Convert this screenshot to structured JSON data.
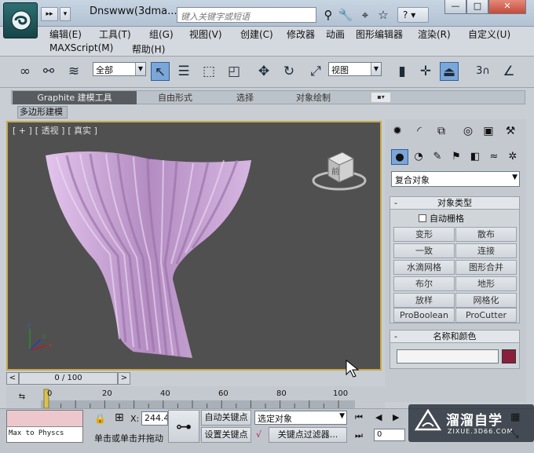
{
  "titlebar": {
    "doc_title": "Dnswww(3dma...",
    "search_placeholder": "键入关键字或短语",
    "help_label": "?",
    "window_buttons": [
      "—",
      "□",
      "✕"
    ],
    "qat_labels": [
      "▸▸",
      "▾"
    ]
  },
  "menus": {
    "row1": [
      "编辑(E)",
      "工具(T)",
      "组(G)",
      "视图(V)",
      "创建(C)",
      "修改器",
      "动画",
      "图形编辑器",
      "渲染(R)",
      "自定义(U)"
    ],
    "row2": [
      "MAXScript(M)",
      "帮助(H)"
    ]
  },
  "toolbar": {
    "selection_filter": "全部",
    "ref_coord": "视图",
    "snap_label": "3"
  },
  "ribbon": {
    "tabs": [
      "Graphite 建模工具",
      "自由形式",
      "选择",
      "对象绘制"
    ],
    "panel_label": "多边形建模"
  },
  "viewport": {
    "labels": [
      "[ + ]",
      "[ 透视 ]",
      "[ 真实 ]"
    ],
    "viewcube_text": "前"
  },
  "command_panel": {
    "category": "复合对象",
    "object_type": {
      "title": "对象类型",
      "autogrid": "自动栅格",
      "buttons": [
        "变形",
        "散布",
        "一致",
        "连接",
        "水滴网格",
        "图形合并",
        "布尔",
        "地形",
        "放样",
        "网格化",
        "ProBoolean",
        "ProCutter"
      ]
    },
    "name_color": {
      "title": "名称和颜色",
      "object_name": "",
      "color": "#8a1f3c"
    },
    "rollout_toggle": "-"
  },
  "timeline": {
    "frame": "0 / 100",
    "ticks": [
      "0",
      "20",
      "40",
      "60",
      "80",
      "100"
    ],
    "prev": "<",
    "next": ">"
  },
  "bottom": {
    "maxscript_out": "Max to Physcs",
    "x_label": "X:",
    "x_value": "244.4",
    "auto_key": "自动关键点",
    "set_key": "设置关键点",
    "key_mode": "选定对象",
    "key_filters": "关键点过滤器...",
    "status": "单击或单击并拖动",
    "current_frame": "0"
  },
  "watermark": {
    "brand": "溜溜自学",
    "url": "ZIXUE.3D66.COM"
  },
  "colors": {
    "viewport_bg": "#505050",
    "viewport_border": "#c8a84a",
    "curtain": "#c9a6d6",
    "ribbon_active": "#585c61",
    "selected_tool": "#7ba6d8"
  }
}
